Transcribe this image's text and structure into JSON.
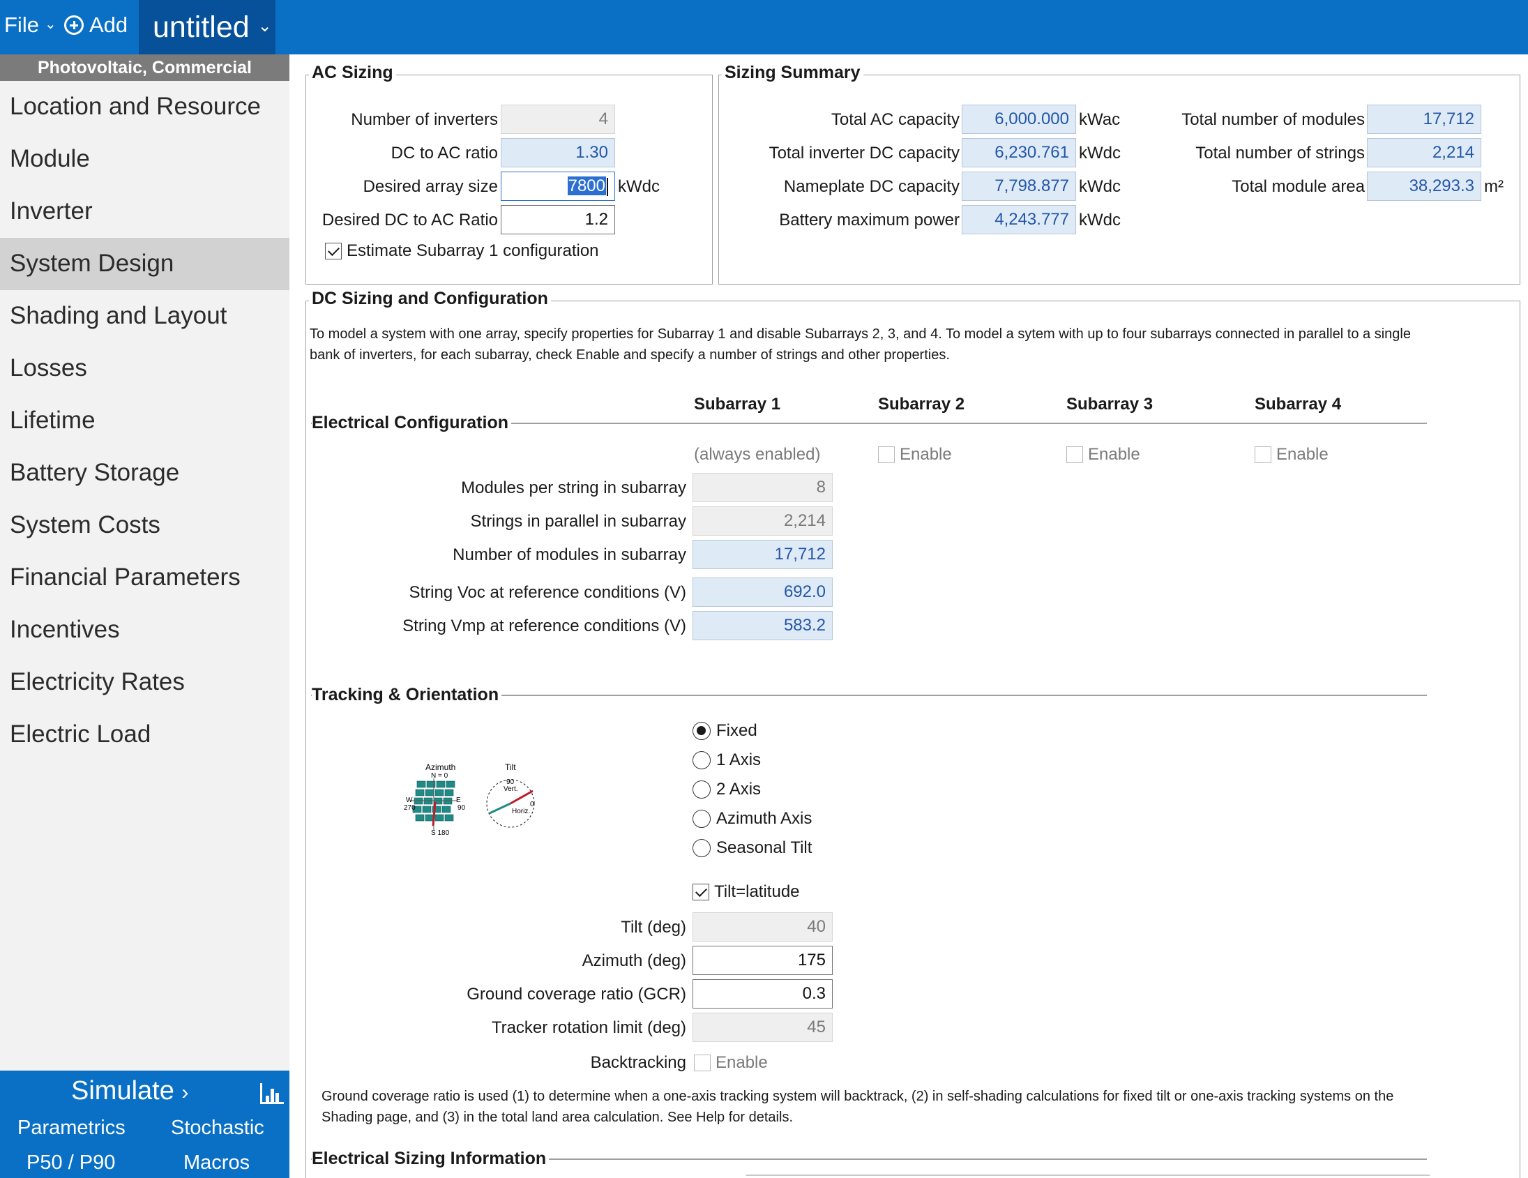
{
  "topbar": {
    "file_label": "File",
    "add_label": "Add",
    "project_name": "untitled"
  },
  "sidebar": {
    "config_title": "Photovoltaic, Commercial",
    "items": [
      {
        "label": "Location and Resource"
      },
      {
        "label": "Module"
      },
      {
        "label": "Inverter"
      },
      {
        "label": "System Design",
        "active": true
      },
      {
        "label": "Shading and Layout"
      },
      {
        "label": "Losses"
      },
      {
        "label": "Lifetime"
      },
      {
        "label": "Battery Storage"
      },
      {
        "label": "System Costs"
      },
      {
        "label": "Financial Parameters"
      },
      {
        "label": "Incentives"
      },
      {
        "label": "Electricity Rates"
      },
      {
        "label": "Electric Load"
      }
    ],
    "simulate": {
      "label": "Simulate",
      "arrow": "›",
      "parametrics": "Parametrics",
      "stochastic": "Stochastic",
      "p50p90": "P50 / P90",
      "macros": "Macros"
    }
  },
  "ac_sizing": {
    "title": "AC Sizing",
    "num_inverters_label": "Number of inverters",
    "num_inverters": "4",
    "dc_ac_ratio_label": "DC to AC ratio",
    "dc_ac_ratio": "1.30",
    "desired_array_size_label": "Desired array size",
    "desired_array_size": "7800",
    "desired_array_size_unit": "kWdc",
    "desired_dc_ac_ratio_label": "Desired DC to AC Ratio",
    "desired_dc_ac_ratio": "1.2",
    "estimate_label": "Estimate Subarray 1 configuration",
    "estimate_checked": true
  },
  "sizing_summary": {
    "title": "Sizing Summary",
    "total_ac_label": "Total AC capacity",
    "total_ac": "6,000.000",
    "total_ac_unit": "kWac",
    "total_inv_dc_label": "Total inverter DC capacity",
    "total_inv_dc": "6,230.761",
    "total_inv_dc_unit": "kWdc",
    "nameplate_label": "Nameplate DC capacity",
    "nameplate": "7,798.877",
    "nameplate_unit": "kWdc",
    "battery_label": "Battery maximum power",
    "battery": "4,243.777",
    "battery_unit": "kWdc",
    "modules_label": "Total number of modules",
    "modules": "17,712",
    "strings_label": "Total number of strings",
    "strings": "2,214",
    "area_label": "Total module area",
    "area": "38,293.3",
    "area_unit": "m²"
  },
  "dc_sizing": {
    "title": "DC Sizing and Configuration",
    "description": "To model a system with one array, specify properties for Subarray 1 and disable Subarrays 2, 3, and 4.  To model a sytem with up to four subarrays connected in parallel to a single bank of inverters, for each subarray, check Enable and specify a number of strings and other properties.",
    "electrical_config_title": "Electrical Configuration",
    "subarray_headers": [
      "Subarray 1",
      "Subarray 2",
      "Subarray 3",
      "Subarray 4"
    ],
    "always_enabled": "(always enabled)",
    "enable_label": "Enable",
    "modules_per_string_label": "Modules per string in subarray",
    "modules_per_string": "8",
    "strings_parallel_label": "Strings in parallel in subarray",
    "strings_parallel": "2,214",
    "num_modules_label": "Number of modules in subarray",
    "num_modules": "17,712",
    "voc_label": "String Voc at reference conditions (V)",
    "voc": "692.0",
    "vmp_label": "String Vmp at reference conditions (V)",
    "vmp": "583.2"
  },
  "tracking": {
    "title": "Tracking & Orientation",
    "options": [
      "Fixed",
      "1 Axis",
      "2 Axis",
      "Azimuth Axis",
      "Seasonal Tilt"
    ],
    "selected": "Fixed",
    "tilt_latitude_label": "Tilt=latitude",
    "tilt_latitude_checked": true,
    "tilt_label": "Tilt (deg)",
    "tilt": "40",
    "azimuth_label": "Azimuth (deg)",
    "azimuth": "175",
    "gcr_label": "Ground coverage ratio (GCR)",
    "gcr": "0.3",
    "rotation_label": "Tracker rotation limit (deg)",
    "rotation": "45",
    "backtracking_label": "Backtracking",
    "backtracking_enable": "Enable",
    "note": "Ground coverage ratio is used (1) to determine when a one-axis tracking system will backtrack, (2) in self-shading calculations for fixed tilt or one-axis tracking systems on the Shading page, and (3) in the total land area calculation. See Help for details.",
    "diagram": {
      "azimuth": "Azimuth",
      "n": "N = 0",
      "w": "W",
      "w270": "270",
      "e": "E",
      "e90": "90",
      "s": "S 180",
      "tilt": "Tilt",
      "t90": "90",
      "vert": "Vert.",
      "t0": "0",
      "horiz": "Horiz."
    }
  },
  "electrical_sizing": {
    "title": "Electrical Sizing Information"
  },
  "colors": {
    "brand_blue": "#0a70c6",
    "calc_field_bg": "#dfeaf7",
    "calc_text": "#2457a8"
  }
}
